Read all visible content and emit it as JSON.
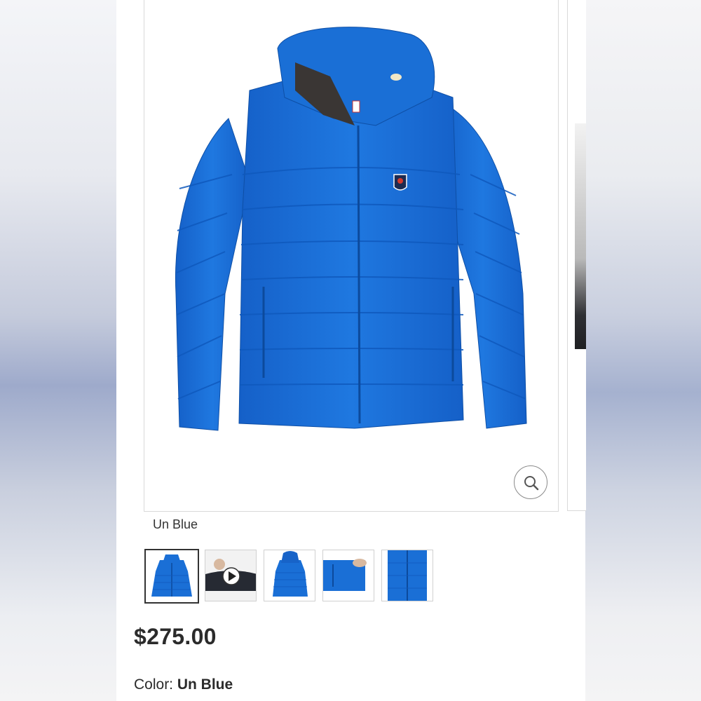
{
  "product": {
    "image_caption": "Un Blue",
    "price": "$275.00",
    "color_label": "Color:",
    "color_value": "Un Blue"
  },
  "gallery": {
    "thumbnails": [
      {
        "name": "front-view",
        "selected": true
      },
      {
        "name": "video",
        "selected": false
      },
      {
        "name": "back-view",
        "selected": false
      },
      {
        "name": "pocket-detail",
        "selected": false
      },
      {
        "name": "fabric-detail",
        "selected": false
      }
    ]
  },
  "colors": {
    "jacket": "#1a6fd6",
    "jacket_shadow": "#0f58b8",
    "jacket_highlight": "#2f86ea"
  },
  "icons": {
    "zoom": "magnifier-icon",
    "play": "play-icon"
  }
}
